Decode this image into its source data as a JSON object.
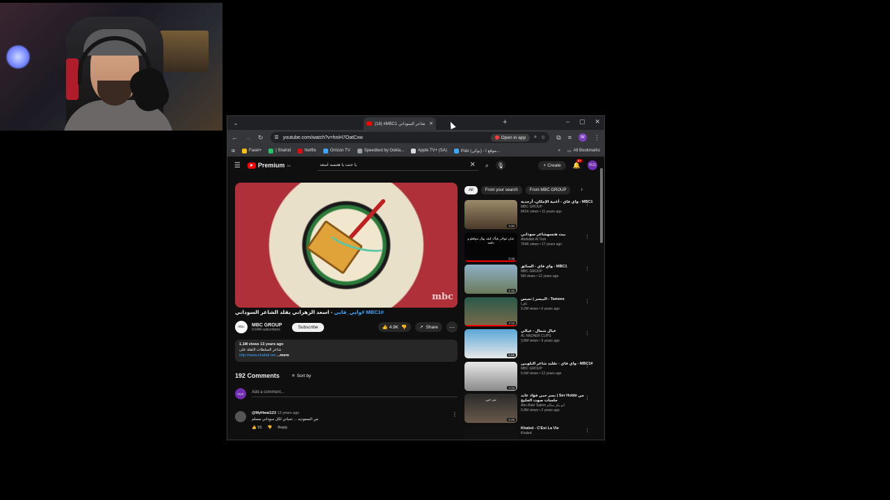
{
  "browser": {
    "tab_title": "(18) #MBC1 شاعر السوداني",
    "url": "youtube.com/watch?v=hniH7OatCxw",
    "open_in_app": "Open in app",
    "profile_initial": "W",
    "bookmarks": [
      {
        "label": "Fasel+",
        "color": "#ffc107"
      },
      {
        "label": "| Shahid",
        "color": "#27c46a"
      },
      {
        "label": "Netflix",
        "color": "#e50914"
      },
      {
        "label": "Orrizon TV",
        "color": "#3ea6ff"
      },
      {
        "label": "Speedtest by Ookla...",
        "color": "#9aa0a6"
      },
      {
        "label": "Apple TV+ (SA)",
        "color": "#ddd"
      },
      {
        "label": "Poki (بوكي) - موقع ا...",
        "color": "#3ea6ff"
      }
    ],
    "all_bookmarks": "All Bookmarks"
  },
  "youtube": {
    "premium_label": "Premium",
    "premium_region": "SA",
    "search_query": "يا حنت يا هتنسه اسعد",
    "create_label": "Create",
    "notif_badge": "9+",
    "account_label": "VLG"
  },
  "video": {
    "watermark": "mbc",
    "title_tag": "#MBC1 #وايي_فايي",
    "title_text": "- اسعد الزهراني يقلد الشاعر السوداني",
    "channel_name": "MBC GROUP",
    "channel_avatar": "mbc",
    "subscribers": "9.64M subscribers",
    "subscribe_label": "Subscribe",
    "likes": "4.9K",
    "share_label": "Share",
    "description": {
      "meta": "1.1M views  13 years ago",
      "line2": "شاعر السلطات الثقلة على",
      "link": "http://www.shahid.net",
      "more": "...more"
    }
  },
  "comments": {
    "count_label": "192 Comments",
    "sort_label": "Sort by",
    "add_placeholder": "Add a comment...",
    "items": [
      {
        "user": "@MyHwai123",
        "time": "13 years ago",
        "text": "من السعوديه ... تحياتي لكل سوداني مسلم",
        "likes": "55",
        "reply": "Reply"
      }
    ]
  },
  "chips": [
    "All",
    "From your search",
    "From MBC GROUP"
  ],
  "recommendations": [
    {
      "title": "واي فاي - أغنية الإمكان، أرجدية - MBC1",
      "channel": "MBC GROUP",
      "meta": "841K views • 11 years ago",
      "duration": "3:26",
      "progress": 0.0,
      "thumb": "linear-gradient(#9a8a6a,#4a3a2a)",
      "caption": ""
    },
    {
      "title": "بيت هتسهشاعر سوداني",
      "channel": "Abdullah Al Turk",
      "meta": "764K views • 17 years ago",
      "duration": "3:15",
      "progress": 1.0,
      "thumb": "#050505",
      "caption": "عنان تتوحّى هيأك كيف بهال يتواهلو و دلعبه"
    },
    {
      "title": "واي فاي - السائق - MBC1",
      "channel": "MBC GROUP",
      "meta": "5M views • 12 years ago",
      "duration": "5:16",
      "progress": 0.0,
      "thumb": "linear-gradient(#8fb0c8,#6a7a5a)",
      "caption": ""
    },
    {
      "title": "البيسر | تميس - Tamees",
      "channel": "تاقرا",
      "meta": "9.2M views • 6 years ago",
      "duration": "4:12",
      "progress": 1.0,
      "thumb": "linear-gradient(#2a5a4a,#7a6a4a)",
      "caption": ""
    },
    {
      "title": "عيال شمال - عيالي",
      "channel": "AL NAZAER CLIPS",
      "meta": "3.8M views • 9 years ago",
      "duration": "5:55",
      "progress": 0.0,
      "thumb": "linear-gradient(#5aa6d8,#e8e8e8)",
      "caption": ""
    },
    {
      "title": "واي فاي - تقليد شاعر النلوبين - MBC1#",
      "channel": "MBC GROUP",
      "meta": "5.6M views • 12 years ago",
      "duration": "3:13",
      "progress": 0.0,
      "thumb": "linear-gradient(#e8e8e8,#8a8a8a)",
      "caption": ""
    },
    {
      "title": "بسر حبي فؤاد عابد | Ser Hobbi من جلسات صوت الخليج",
      "channel": "Abu Bakr Salem ابو بكر سالم",
      "meta": "5.8M views • 2 years ago",
      "duration": "8:29",
      "progress": 0.0,
      "thumb": "linear-gradient(#2a2a2a,#6a5a4a)",
      "caption": "سر حبي"
    },
    {
      "title": "Khaled - C'Est La Vie",
      "channel": "Khaled",
      "meta": "",
      "duration": "",
      "progress": 0.0,
      "thumb": "#111",
      "caption": ""
    }
  ]
}
